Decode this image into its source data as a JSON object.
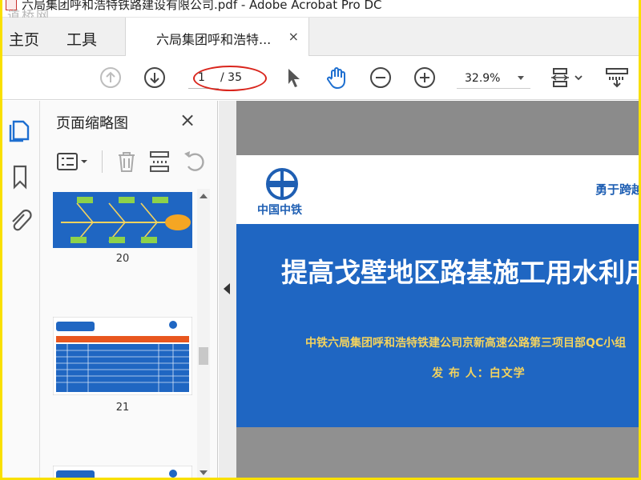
{
  "window": {
    "title": "六局集团呼和浩特铁路建设有限公司.pdf - Adobe Acrobat Pro DC",
    "watermark": "道桥网"
  },
  "menu": {
    "home": "主页",
    "tools": "工具"
  },
  "tab": {
    "label": "六局集团呼和浩特...",
    "close": "×"
  },
  "toolbar": {
    "page_current": "1",
    "page_total": "/ 35",
    "zoom": "32.9%"
  },
  "panel": {
    "title": "页面缩略图",
    "close": "×",
    "thumbnails": [
      {
        "page": "20"
      },
      {
        "page": "21"
      }
    ]
  },
  "document": {
    "logo_text": "中国中铁",
    "slogan": "勇于跨越",
    "headline": "提高戈壁地区路基施工用水利用",
    "subtitle": "中铁六局集团呼和浩特铁建公司京新高速公路第三项目部QC小组",
    "issuer": "发 布 人：白文学"
  },
  "colors": {
    "accent_blue": "#1f66c2",
    "annotation_red": "#d9251c",
    "frame_yellow": "#f9e000"
  }
}
